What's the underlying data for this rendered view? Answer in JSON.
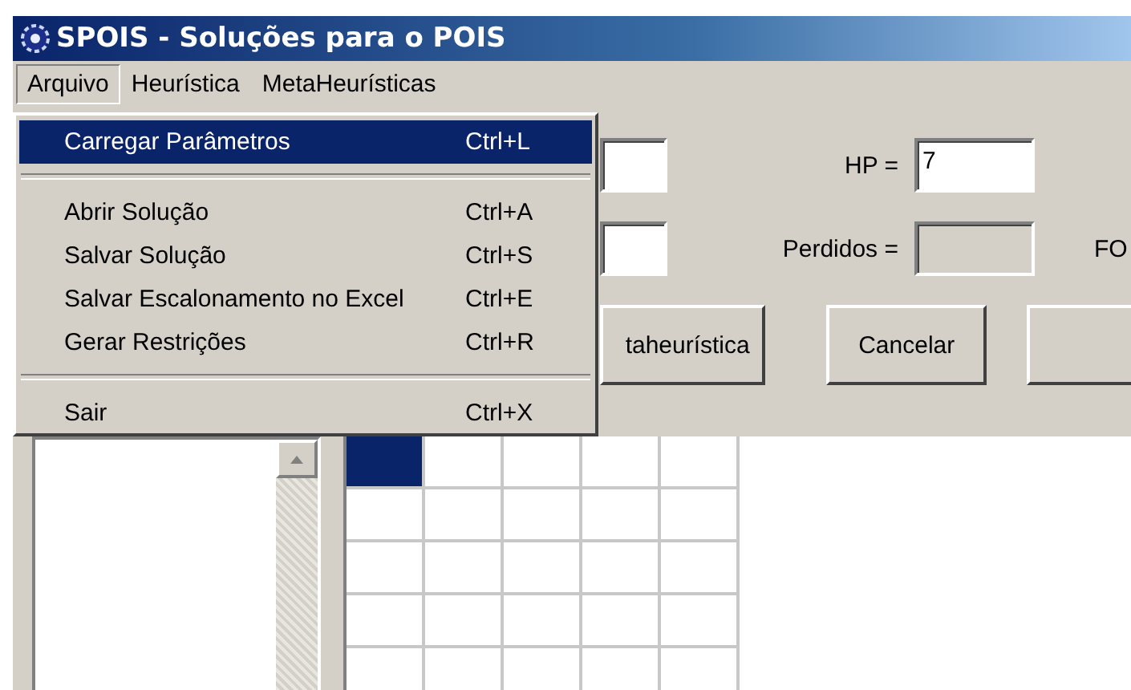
{
  "window": {
    "title": "SPOIS - Soluções para o POIS"
  },
  "menu_bar": [
    {
      "label": "Arquivo",
      "selected": true
    },
    {
      "label": "Heurística",
      "selected": false
    },
    {
      "label": "MetaHeurísticas",
      "selected": false
    }
  ],
  "dropdown": [
    {
      "kind": "item",
      "label": "Carregar Parâmetros",
      "shortcut": "Ctrl+L",
      "selected": true
    },
    {
      "kind": "separator"
    },
    {
      "kind": "item",
      "label": "Abrir Solução",
      "shortcut": "Ctrl+A",
      "selected": false
    },
    {
      "kind": "item",
      "label": "Salvar Solução",
      "shortcut": "Ctrl+S",
      "selected": false
    },
    {
      "kind": "item",
      "label": "Salvar Escalonamento no Excel",
      "shortcut": "Ctrl+E",
      "selected": false
    },
    {
      "kind": "item",
      "label": "Gerar Restrições",
      "shortcut": "Ctrl+R",
      "selected": false
    },
    {
      "kind": "separator"
    },
    {
      "kind": "item",
      "label": "Sair",
      "shortcut": "Ctrl+X",
      "selected": false
    }
  ],
  "form": {
    "hp": {
      "label": "HP =",
      "value": "7",
      "disabled": false
    },
    "perdidos": {
      "label": "Perdidos =",
      "disabled": true
    },
    "fo": {
      "label": "FO"
    },
    "buttons": [
      {
        "kind": "button",
        "label": "taheurística"
      },
      {
        "kind": "button",
        "label": "Cancelar"
      },
      {
        "kind": "button"
      }
    ]
  },
  "grid": {
    "rows": [
      {
        "cells": [
          {
            "selected": true
          },
          {
            "selected": false
          },
          {
            "selected": false
          },
          {
            "selected": false
          },
          {
            "selected": false
          }
        ]
      },
      {
        "cells": [
          {
            "selected": false
          },
          {
            "selected": false
          },
          {
            "selected": false
          },
          {
            "selected": false
          },
          {
            "selected": false
          }
        ]
      },
      {
        "cells": [
          {
            "selected": false
          },
          {
            "selected": false
          },
          {
            "selected": false
          },
          {
            "selected": false
          },
          {
            "selected": false
          }
        ]
      },
      {
        "cells": [
          {
            "selected": false
          },
          {
            "selected": false
          },
          {
            "selected": false
          },
          {
            "selected": false
          },
          {
            "selected": false
          }
        ]
      },
      {
        "cells": [
          {
            "selected": false
          },
          {
            "selected": false
          },
          {
            "selected": false
          },
          {
            "selected": false
          },
          {
            "selected": false
          }
        ]
      }
    ]
  }
}
